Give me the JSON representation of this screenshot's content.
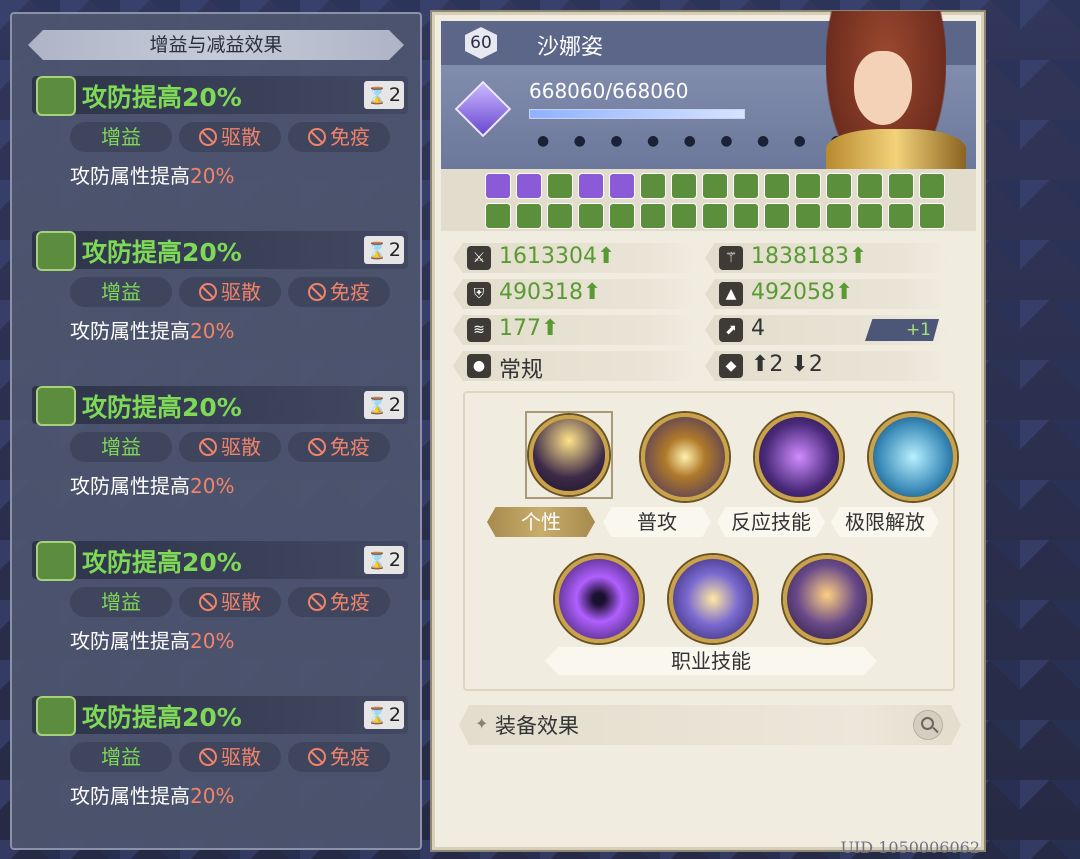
{
  "left": {
    "title": "增益与减益效果",
    "buffs": [
      {
        "name": "攻防提高20%",
        "turns": "2",
        "tag_good": "增益",
        "tag_dispel": "驱散",
        "tag_immune": "免疫",
        "desc": "攻防属性提高",
        "desc_pct": "20%"
      },
      {
        "name": "攻防提高20%",
        "turns": "2",
        "tag_good": "增益",
        "tag_dispel": "驱散",
        "tag_immune": "免疫",
        "desc": "攻防属性提高",
        "desc_pct": "20%"
      },
      {
        "name": "攻防提高20%",
        "turns": "2",
        "tag_good": "增益",
        "tag_dispel": "驱散",
        "tag_immune": "免疫",
        "desc": "攻防属性提高",
        "desc_pct": "20%"
      },
      {
        "name": "攻防提高20%",
        "turns": "2",
        "tag_good": "增益",
        "tag_dispel": "驱散",
        "tag_immune": "免疫",
        "desc": "攻防属性提高",
        "desc_pct": "20%"
      },
      {
        "name": "攻防提高20%",
        "turns": "2",
        "tag_good": "增益",
        "tag_dispel": "驱散",
        "tag_immune": "免疫",
        "desc": "攻防属性提高",
        "desc_pct": "20%"
      }
    ]
  },
  "hero": {
    "level": "60",
    "name": "沙娜姿",
    "hp": "668060/668060",
    "hp_fraction": 1.0,
    "dots": "● ● ● ● ● ● ● ● ● ● ●"
  },
  "stats": {
    "atk": "1613304⬆",
    "mag": "1838183⬆",
    "def": "490318⬆",
    "mdef": "492058⬆",
    "spd": "177⬆",
    "move": "4",
    "move_bonus": "+1",
    "type": "常规",
    "jump": "⬆2 ⬇2"
  },
  "skills": {
    "personality": "个性",
    "normal": "普攻",
    "reaction": "反应技能",
    "ultimate": "极限解放",
    "class_skills": "职业技能"
  },
  "equip": {
    "label": "装备效果"
  },
  "uid": "UID 1050006062",
  "colors": {
    "buff_green": "#7ed957",
    "debuff_red": "#f0846a",
    "panel_bg": "#f1ece0"
  }
}
